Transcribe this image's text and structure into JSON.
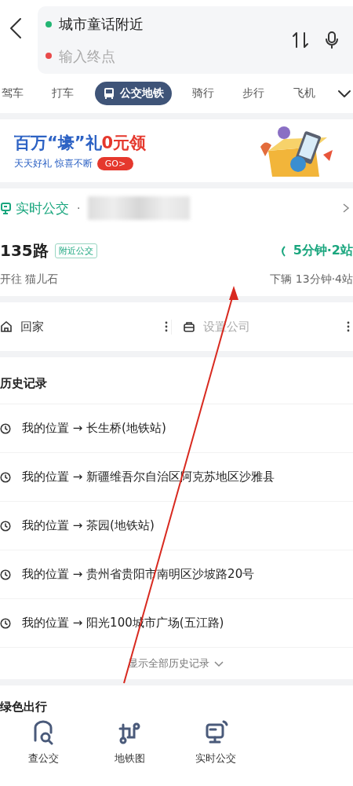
{
  "search": {
    "start": "城市童话附近",
    "end_placeholder": "输入终点"
  },
  "modes": [
    {
      "label": "驾车",
      "selected": false
    },
    {
      "label": "打车",
      "selected": false
    },
    {
      "label": "公交地铁",
      "selected": true
    },
    {
      "label": "骑行",
      "selected": false
    },
    {
      "label": "步行",
      "selected": false
    },
    {
      "label": "飞机",
      "selected": false
    }
  ],
  "banner": {
    "title_start": "百万“壕”礼",
    "title_end": "0元领",
    "subtitle": "天天好礼 惊喜不断",
    "button": "GO>",
    "kind": "picture"
  },
  "realtime": {
    "title": "实时公交",
    "separator": "·",
    "route": "135路",
    "tag": "附近公交",
    "eta": "5分钟·2站",
    "direction": "开往 猫儿石",
    "next": "下辆 13分钟·4站"
  },
  "shortcuts": [
    {
      "kind": "home",
      "label": "回家",
      "disabled": false
    },
    {
      "kind": "work",
      "label": "设置公司",
      "disabled": true
    }
  ],
  "history": {
    "title": "历史记录",
    "items": [
      {
        "from": "我的位置",
        "arrow": "→",
        "to": "长生桥(地铁站)"
      },
      {
        "from": "我的位置",
        "arrow": "→",
        "to": "新疆维吾尔自治区阿克苏地区沙雅县"
      },
      {
        "from": "我的位置",
        "arrow": "→",
        "to": "茶园(地铁站)"
      },
      {
        "from": "我的位置",
        "arrow": "→",
        "to": "贵州省贵阳市南明区沙坡路20号"
      },
      {
        "from": "我的位置",
        "arrow": "→",
        "to": "阳光100城市广场(五江路)"
      }
    ],
    "more": "显示全部历史记录"
  },
  "green": {
    "title": "绿色出行",
    "items": [
      {
        "kind": "bus-search",
        "label": "查公交"
      },
      {
        "kind": "metro",
        "label": "地铁图"
      },
      {
        "kind": "realtime",
        "label": "实时公交"
      }
    ]
  }
}
